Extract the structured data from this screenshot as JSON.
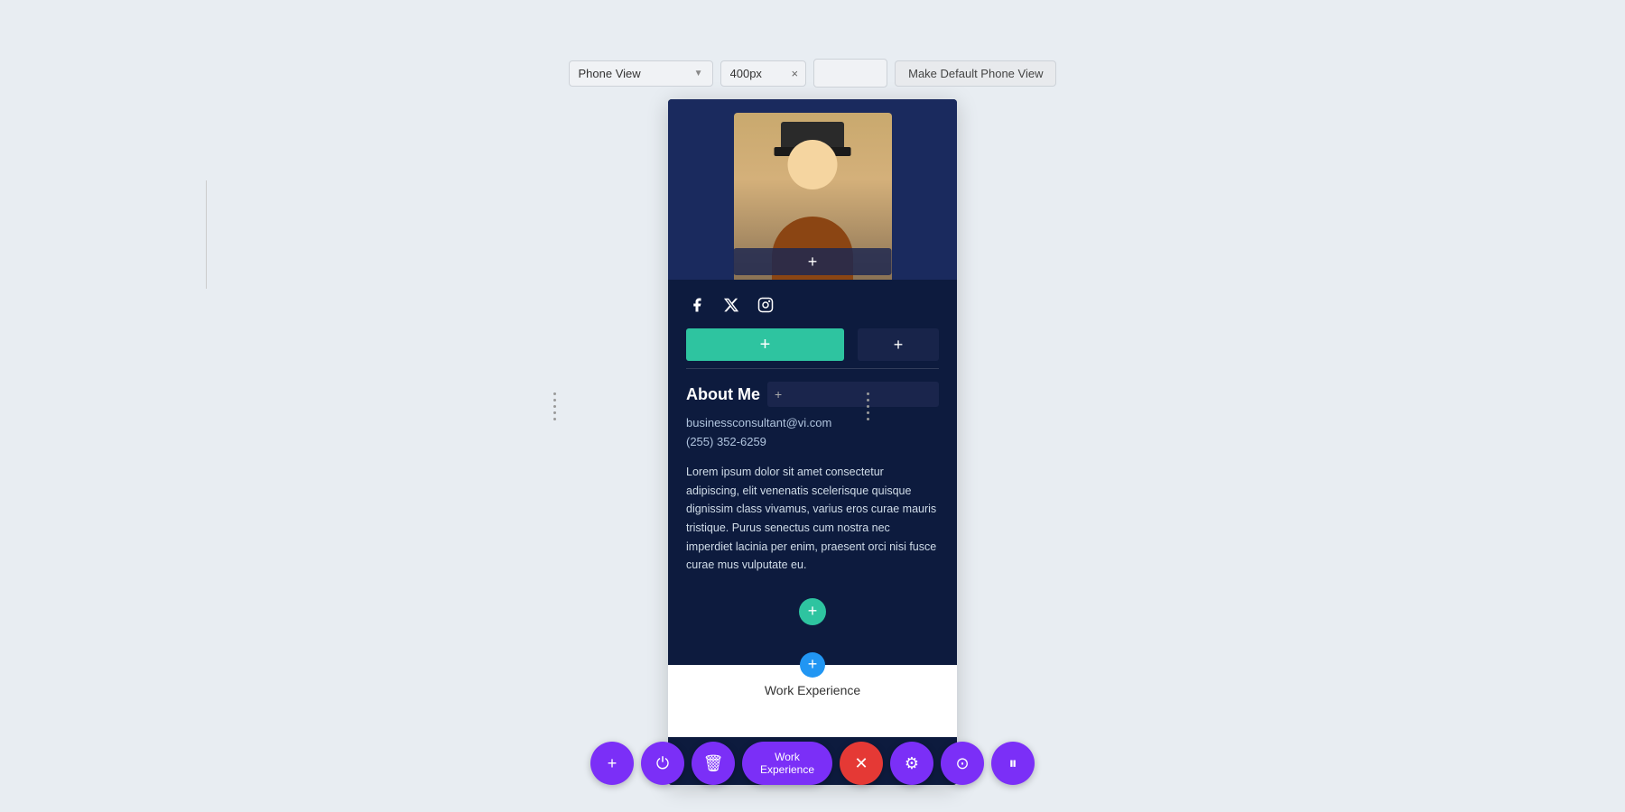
{
  "toolbar": {
    "view_selector_label": "Phone View",
    "width_value": "400px",
    "clear_button": "×",
    "make_default_label": "Make Default Phone View"
  },
  "profile": {
    "social_icons": [
      "facebook",
      "twitter-x",
      "instagram"
    ],
    "add_bar_plus": "+",
    "add_overlay_plus": "+",
    "about_title": "About Me",
    "about_title_overlay_icon": "+",
    "email": "businessconsultant@vi.com",
    "phone": "(255) 352-6259",
    "lorem_text": "Lorem ipsum dolor sit amet consectetur adipiscing, elit venenatis scelerisque quisque dignissim class vivamus, varius eros curae mauris tristique. Purus senectus cum nostra nec imperdiet lacinia per enim, praesent orci nisi fusce curae mus vulputate eu.",
    "add_circle_plus": "+",
    "section_sep_plus": "+"
  },
  "white_section": {
    "label": "Work Experience"
  },
  "bottom_toolbar": {
    "buttons": [
      {
        "icon": "+",
        "name": "add"
      },
      {
        "icon": "⏻",
        "name": "power"
      },
      {
        "icon": "🗑",
        "name": "delete"
      },
      {
        "icon": "Work Experience",
        "name": "label"
      },
      {
        "icon": "×",
        "name": "close"
      },
      {
        "icon": "⚙",
        "name": "settings"
      },
      {
        "icon": "⊙",
        "name": "history"
      },
      {
        "icon": "⏸",
        "name": "pause"
      }
    ]
  },
  "colors": {
    "bg": "#e8edf2",
    "phone_bg": "#0d1b3e",
    "teal": "#2ec4a0",
    "purple": "#7b2ff7",
    "red": "#e53935",
    "blue": "#2196f3"
  }
}
